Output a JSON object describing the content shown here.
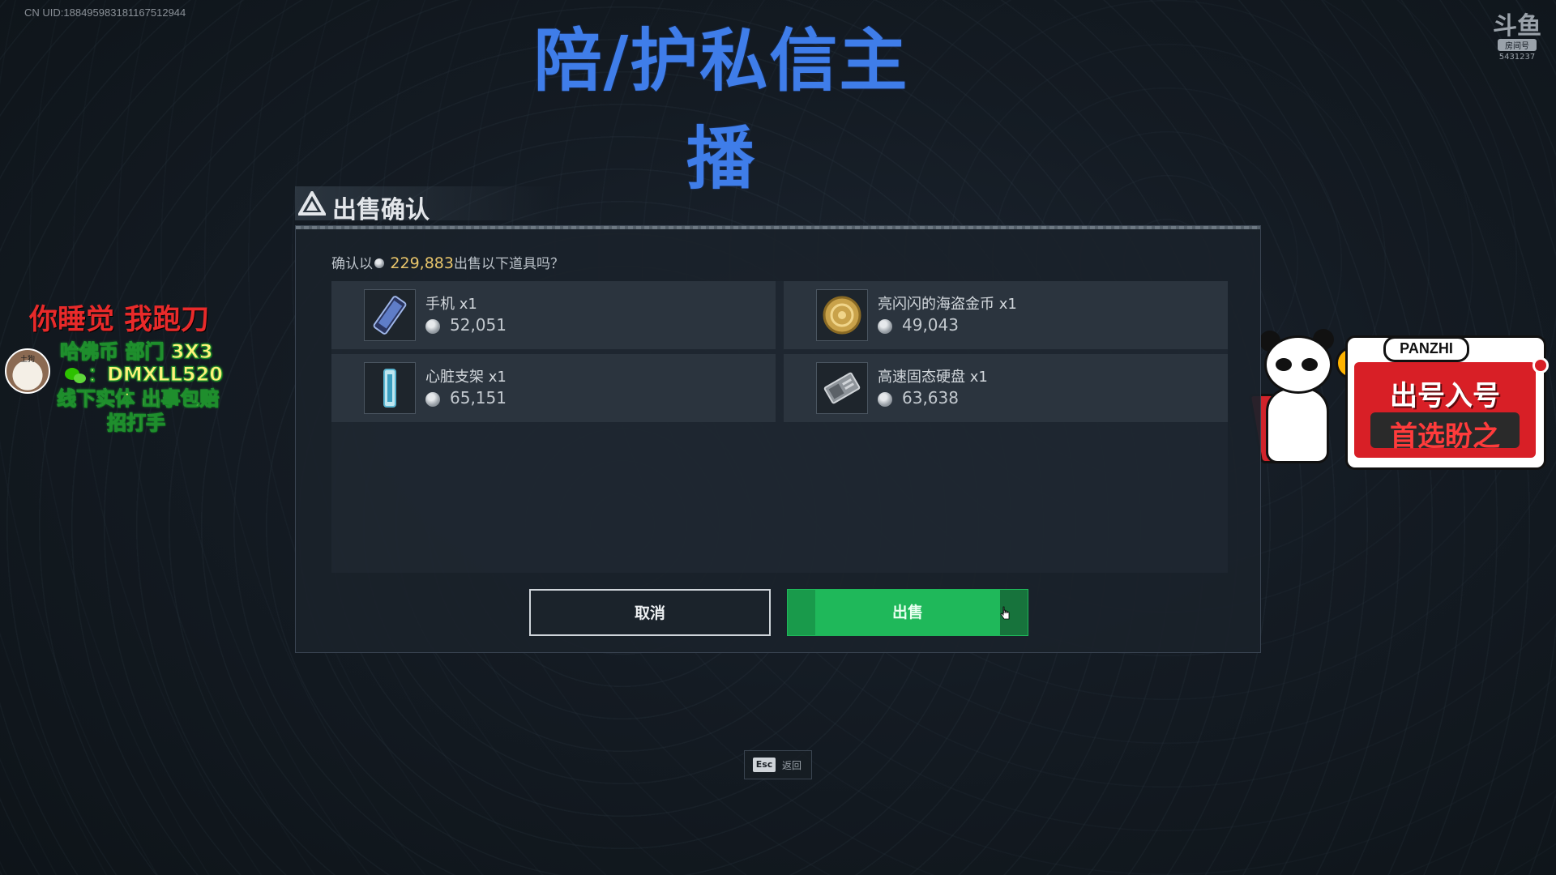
{
  "stream": {
    "uid_text": "CN UID:1884959831811675129​44",
    "title": "陪/护私信主播",
    "douyu_logo": {
      "glyph": "斗鱼",
      "tag": "房间号",
      "room_number": "5431237"
    }
  },
  "left_overlay": {
    "line1": "你睡觉 我跑刀",
    "line2": "哈佛币 部门 3X3",
    "line3": "：DMXLL520",
    "line4": "线下实体 出事包赔",
    "line5": "招打手",
    "avatar_label": "土狗",
    "wechat_icon": "wechat-icon"
  },
  "right_overlay": {
    "brand": "PANZHI",
    "line1": "出号入号",
    "line2": "首选盼之"
  },
  "dialog": {
    "title": "出售确认",
    "icon": "warning-triangle-icon",
    "prompt_prefix": "确认以",
    "total": "229,883",
    "prompt_suffix": "出售以下道具吗？",
    "items": [
      {
        "name": "手机 x1",
        "price": "52,051",
        "icon": "phone-icon"
      },
      {
        "name": "亮闪闪的海盗金币 x1",
        "price": "49,043",
        "icon": "gold-coin-icon"
      },
      {
        "name": "心脏支架 x1",
        "price": "65,151",
        "icon": "heart-stent-icon"
      },
      {
        "name": "高速固态硬盘 x1",
        "price": "63,638",
        "icon": "ssd-icon"
      }
    ],
    "cancel_label": "取消",
    "sell_label": "出售"
  },
  "esc_hint": {
    "key": "Esc",
    "label": "返回"
  },
  "colors": {
    "title_blue": "#3f7de9",
    "sell_green": "#1fb85a",
    "total_gold": "#e8c56b",
    "overlay_red": "#e82a2a",
    "overlay_yellow": "#fff27a"
  }
}
